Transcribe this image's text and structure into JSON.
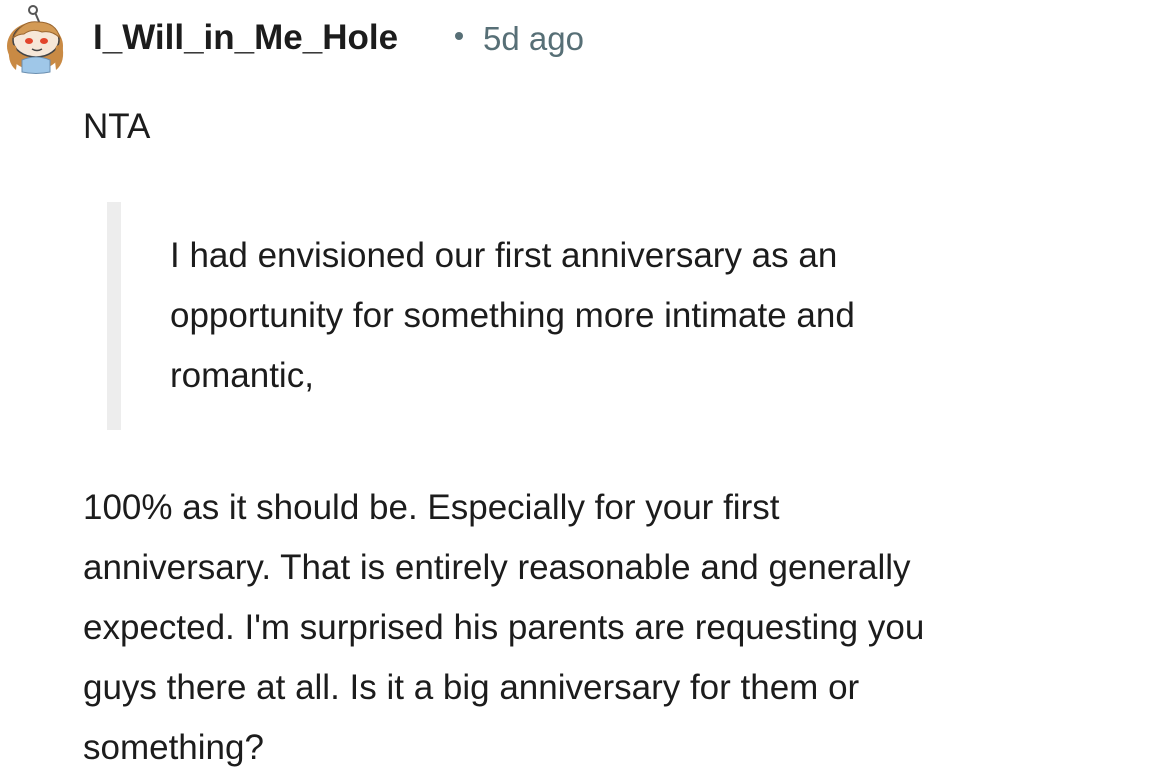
{
  "comment": {
    "author": {
      "username": "I_Will_in_Me_Hole",
      "avatar_icon": "snoo-avatar-icon"
    },
    "separator": "·",
    "timestamp": "5d ago",
    "verdict": "NTA",
    "quote": {
      "lines": [
        "I had envisioned our first anniversary as an",
        "opportunity for something more intimate and",
        "romantic,"
      ]
    },
    "body": {
      "lines": [
        "100% as it should be. Especially for your first",
        "anniversary. That is entirely reasonable and generally",
        "expected. I'm surprised his parents are requesting you",
        "guys there at all. Is it a big anniversary for them or",
        "something?"
      ]
    }
  },
  "colors": {
    "text": "#1c1c1c",
    "meta": "#576f76",
    "quote_bar": "#ededed",
    "background": "#ffffff"
  }
}
